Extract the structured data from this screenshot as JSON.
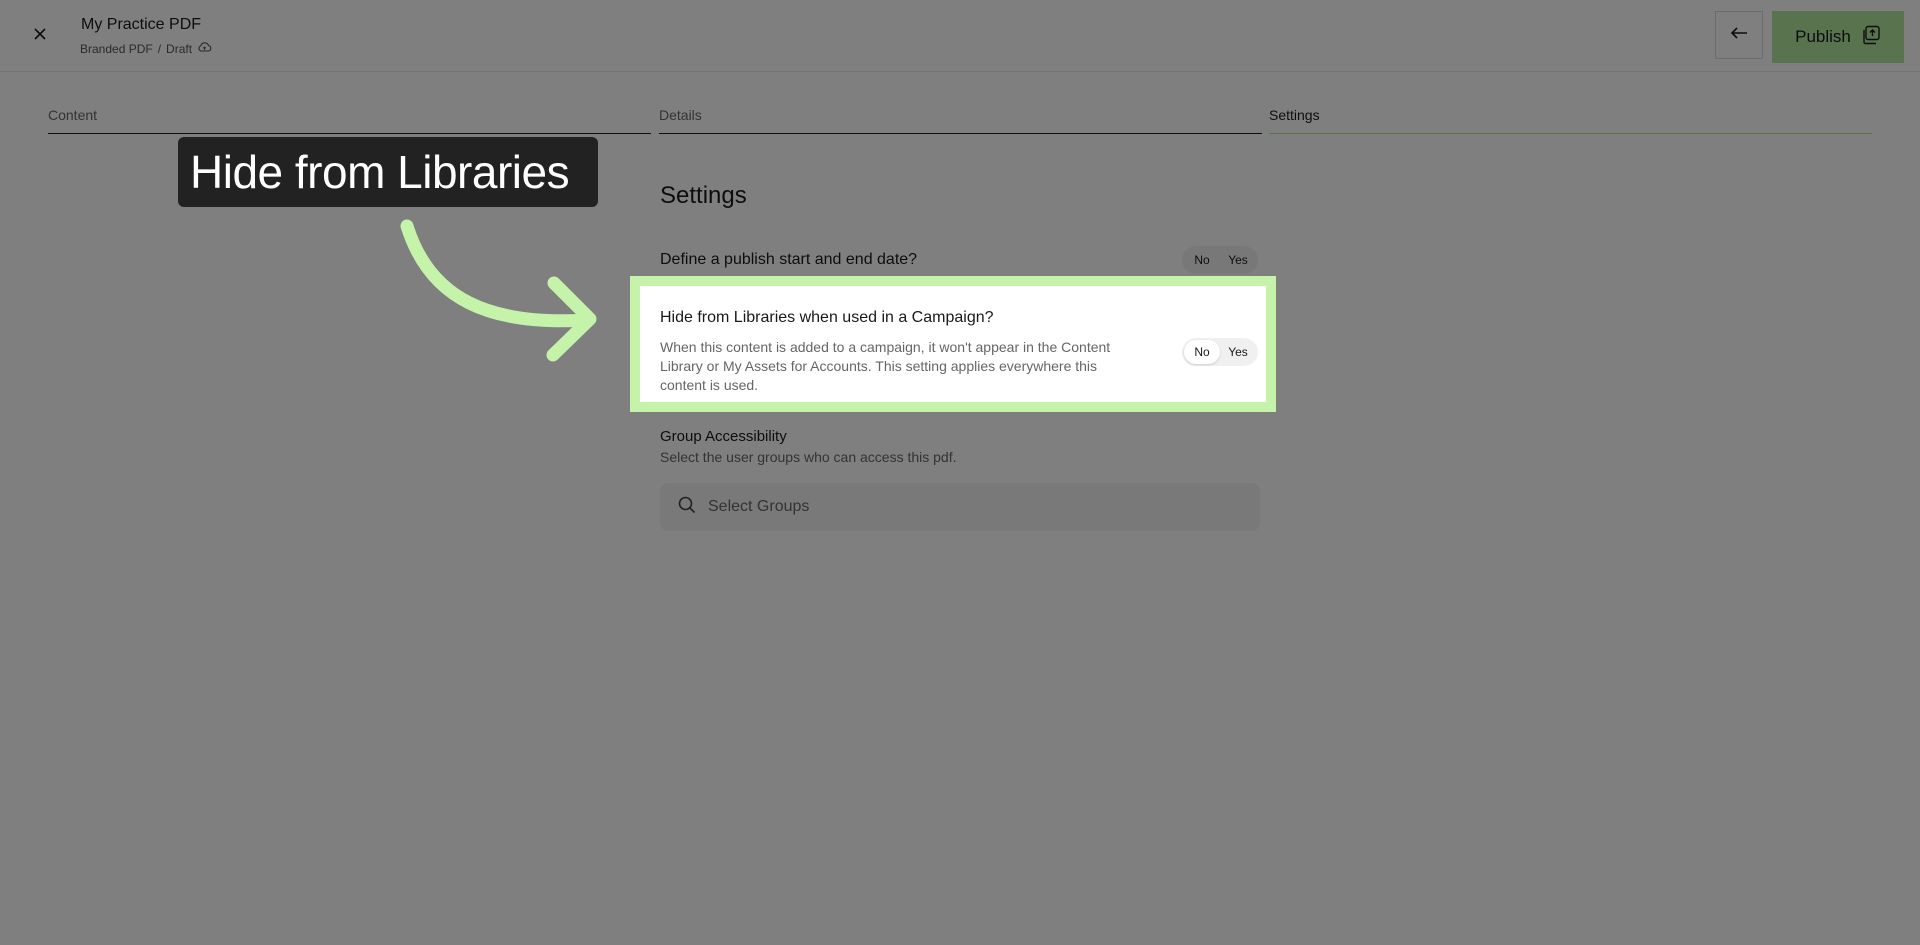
{
  "header": {
    "title": "My Practice PDF",
    "breadcrumb_type": "Branded PDF",
    "breadcrumb_sep": "/",
    "breadcrumb_status": "Draft",
    "publish_label": "Publish"
  },
  "tabs": [
    {
      "label": "Content"
    },
    {
      "label": "Details"
    },
    {
      "label": "Settings",
      "active": true
    }
  ],
  "settings": {
    "heading": "Settings",
    "publish_dates": {
      "label": "Define a publish start and end date?",
      "toggle": {
        "no": "No",
        "yes": "Yes",
        "selected": "none"
      }
    },
    "hide_from_libraries": {
      "label": "Hide from Libraries when used in a Campaign?",
      "description_line1": "When this content is added to a campaign, it won't appear in the Content",
      "description_line2": "Library or My Assets for Accounts. This setting applies everywhere this",
      "description_line3": "content is used.",
      "toggle": {
        "no": "No",
        "yes": "Yes",
        "selected": "No"
      }
    },
    "group_accessibility": {
      "label": "Group Accessibility",
      "description": "Select the user groups who can access this pdf.",
      "search_placeholder": "Select Groups"
    }
  },
  "callout": {
    "text": "Hide from Libraries"
  },
  "colors": {
    "accent_green": "#b2e79c",
    "highlight_green": "#c6f3aa",
    "overlay": "rgba(0,0,0,0.5)",
    "callout_bg": "#222222"
  },
  "icons": [
    "close-icon",
    "cloud-icon",
    "arrow-left-icon",
    "publish-icon",
    "search-icon",
    "callout-arrow-icon"
  ]
}
